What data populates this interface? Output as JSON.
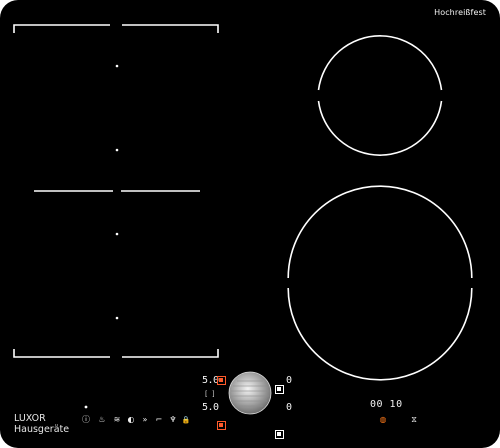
{
  "brand": {
    "line1": "LUXOR",
    "line2": "Hausgeräte"
  },
  "badge": "Hochreißfest",
  "zones": {
    "left_bridge": {
      "type": "flex-bridge",
      "dots": 4
    },
    "right_top": {
      "type": "round",
      "size": "small"
    },
    "right_bottom": {
      "type": "round",
      "size": "large"
    }
  },
  "controls": {
    "zone_upper": {
      "level": "5.0",
      "mode_right": "0"
    },
    "zone_lower": {
      "level": "5.0",
      "mode_right": "0"
    },
    "bridge_symbol": "[ ]",
    "knob": "rotary-knob"
  },
  "timer": {
    "display": "00:10",
    "display_text": "00 10"
  },
  "function_icons": [
    {
      "name": "info-icon",
      "glyph": "ⓘ"
    },
    {
      "name": "steam-icon",
      "glyph": "♨"
    },
    {
      "name": "pot-boil-icon",
      "glyph": "≋"
    },
    {
      "name": "half-circle-icon",
      "glyph": "◐"
    },
    {
      "name": "fast-forward-icon",
      "glyph": "»"
    },
    {
      "name": "pan-icon",
      "glyph": "⌐"
    },
    {
      "name": "grill-icon",
      "glyph": "♆"
    },
    {
      "name": "lock-icon",
      "glyph": "🔒"
    }
  ],
  "timer_icons": [
    {
      "name": "power-timer-icon",
      "glyph": "◍"
    },
    {
      "name": "hourglass-icon",
      "glyph": "⧖"
    }
  ],
  "colors": {
    "accent": "#ff5a2a",
    "lines": "#ffffff",
    "surface": "#000000"
  }
}
